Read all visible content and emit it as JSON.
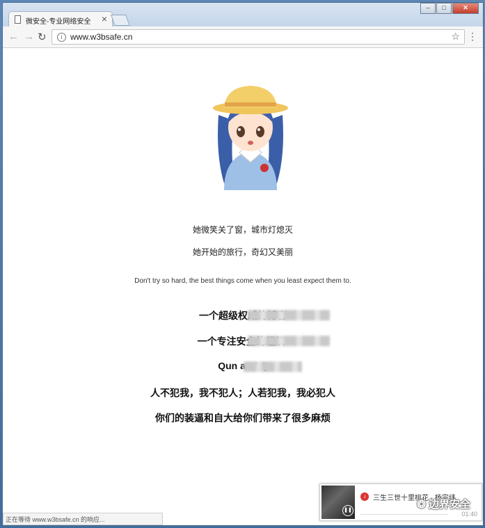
{
  "browser": {
    "tab_title": "微安全-专业网络安全",
    "tab_close": "×",
    "url": "www.w3bsafe.cn",
    "status_text": "正在等待 www.w3bsafe.cn 的响应..."
  },
  "page": {
    "poem_line_1": "她微笑关了窗，城市灯熄灭",
    "poem_line_2": "她开始的旅行，奇幻又美丽",
    "english_quote": "Don't try so hard, the best things come when you least expect them to.",
    "bold_lines": [
      "一个超级权威的博客",
      "一个专注安全的组织-",
      "Qun and Q",
      "人不犯我，我不犯人；人若犯我，我必犯人",
      "你们的装逼和自大给你们带来了很多麻烦"
    ]
  },
  "player": {
    "song": "三生三世十里桃花 - 杨宗纬",
    "time": "01:40"
  },
  "watermark": {
    "text": "边界安全"
  }
}
